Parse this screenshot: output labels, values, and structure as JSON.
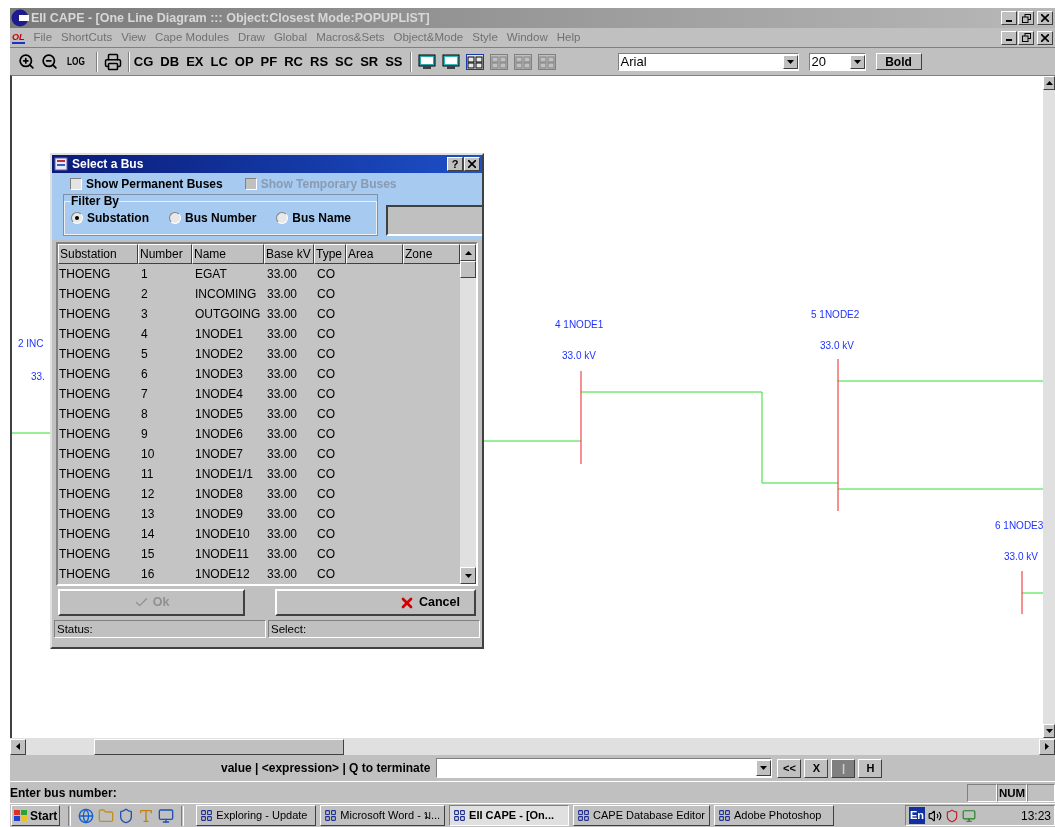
{
  "window": {
    "title": "EII CAPE - [One Line Diagram ::: Object:Closest Mode:POPUPLIST]"
  },
  "menu": {
    "logo": "OL",
    "items": [
      "File",
      "ShortCuts",
      "View",
      "Cape Modules",
      "Draw",
      "Global",
      "Macros&Sets",
      "Object&Mode",
      "Style",
      "Window",
      "Help"
    ]
  },
  "toolbar": {
    "log_button": "LOG",
    "modules": [
      "CG",
      "DB",
      "EX",
      "LC",
      "OP",
      "PF",
      "RC",
      "RS",
      "SC",
      "SR",
      "SS"
    ],
    "font": {
      "value": "Arial"
    },
    "size": {
      "value": "20"
    },
    "bold_button": "Bold"
  },
  "diagram": {
    "buses": [
      {
        "label": "2 INC",
        "voltage": "33."
      },
      {
        "label": "4 1NODE1",
        "voltage": "33.0 kV"
      },
      {
        "label": "5 1NODE2",
        "voltage": "33.0 kV"
      },
      {
        "label": "6 1NODE3",
        "voltage": "33.0 kV"
      }
    ]
  },
  "dialog": {
    "title": "Select a Bus",
    "help": "?",
    "checkboxes": [
      {
        "label": "Show Permanent Buses",
        "checked": false,
        "disabled": false
      },
      {
        "label": "Show Temporary Buses",
        "checked": false,
        "disabled": true
      }
    ],
    "filter": {
      "legend": "Filter By",
      "options": [
        {
          "label": "Substation",
          "selected": true
        },
        {
          "label": "Bus Number",
          "selected": false
        },
        {
          "label": "Bus Name",
          "selected": false
        }
      ]
    },
    "table": {
      "columns": [
        "Substation",
        "Number",
        "Name",
        "Base kV",
        "Type",
        "Area",
        "Zone"
      ],
      "rows": [
        [
          "THOENG",
          "1",
          "EGAT",
          "33.00",
          "CO"
        ],
        [
          "THOENG",
          "2",
          "INCOMING",
          "33.00",
          "CO"
        ],
        [
          "THOENG",
          "3",
          "OUTGOING",
          "33.00",
          "CO"
        ],
        [
          "THOENG",
          "4",
          "1NODE1",
          "33.00",
          "CO"
        ],
        [
          "THOENG",
          "5",
          "1NODE2",
          "33.00",
          "CO"
        ],
        [
          "THOENG",
          "6",
          "1NODE3",
          "33.00",
          "CO"
        ],
        [
          "THOENG",
          "7",
          "1NODE4",
          "33.00",
          "CO"
        ],
        [
          "THOENG",
          "8",
          "1NODE5",
          "33.00",
          "CO"
        ],
        [
          "THOENG",
          "9",
          "1NODE6",
          "33.00",
          "CO"
        ],
        [
          "THOENG",
          "10",
          "1NODE7",
          "33.00",
          "CO"
        ],
        [
          "THOENG",
          "11",
          "1NODE1/1",
          "33.00",
          "CO"
        ],
        [
          "THOENG",
          "12",
          "1NODE8",
          "33.00",
          "CO"
        ],
        [
          "THOENG",
          "13",
          "1NODE9",
          "33.00",
          "CO"
        ],
        [
          "THOENG",
          "14",
          "1NODE10",
          "33.00",
          "CO"
        ],
        [
          "THOENG",
          "15",
          "1NODE11",
          "33.00",
          "CO"
        ],
        [
          "THOENG",
          "16",
          "1NODE12",
          "33.00",
          "CO"
        ]
      ]
    },
    "buttons": [
      {
        "label": "Ok",
        "kind": "ok",
        "disabled": true
      },
      {
        "label": "Cancel",
        "kind": "cancel",
        "disabled": false
      }
    ],
    "status": [
      "Status:",
      "Select:"
    ]
  },
  "command_bar": {
    "prompt": "value | <expression> | Q to terminate",
    "buttons": [
      {
        "label": "<<",
        "disabled": false
      },
      {
        "label": "X",
        "disabled": false
      },
      {
        "label": "|",
        "disabled": true
      },
      {
        "label": "H",
        "disabled": false
      }
    ]
  },
  "status_bar": {
    "message": "Enter bus number:",
    "indicator": "NUM"
  },
  "taskbar": {
    "start": "Start",
    "tasks": [
      {
        "label": "Exploring - Update",
        "selected": false
      },
      {
        "label": "Microsoft Word - ม...",
        "selected": false
      },
      {
        "label": "EII CAPE - [On...",
        "selected": true
      },
      {
        "label": "CAPE Database Editor",
        "selected": false
      },
      {
        "label": "Adobe Photoshop",
        "selected": false
      }
    ],
    "language": "En",
    "clock": "13:23"
  }
}
